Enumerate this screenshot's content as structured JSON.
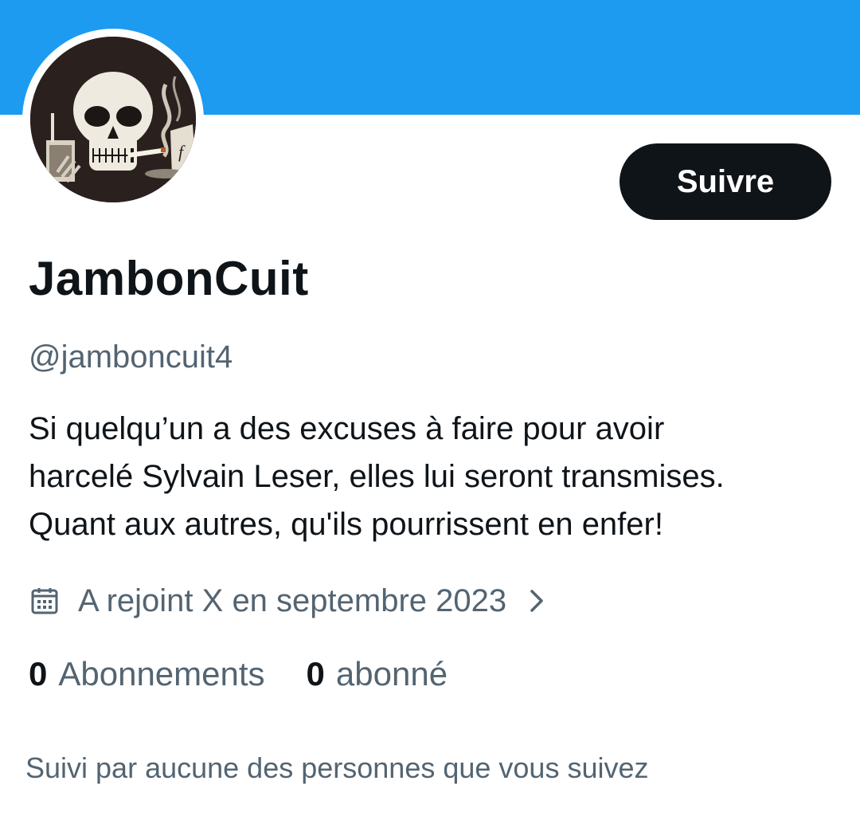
{
  "profile": {
    "display_name": "JambonCuit",
    "handle": "@jamboncuit4",
    "bio_lines": [
      "Si quelqu’un a des excuses à faire pour avoir",
      "harcelé Sylvain Leser, elles lui seront transmises.",
      "Quant aux autres, qu'ils pourrissent en enfer!"
    ],
    "joined": "A rejoint X en septembre 2023",
    "followed_by": "Suivi par aucune des personnes que vous suivez"
  },
  "actions": {
    "follow_label": "Suivre"
  },
  "stats": {
    "following_count": "0",
    "following_label": "Abonnements",
    "followers_count": "0",
    "followers_label": "abonné"
  },
  "icons": {
    "joined": "calendar-icon",
    "joined_more": "chevron-right-icon"
  },
  "colors": {
    "banner": "#1d9bf0",
    "primary_text": "#0f1419",
    "secondary_text": "#536471",
    "follow_button_bg": "#0f1419"
  }
}
